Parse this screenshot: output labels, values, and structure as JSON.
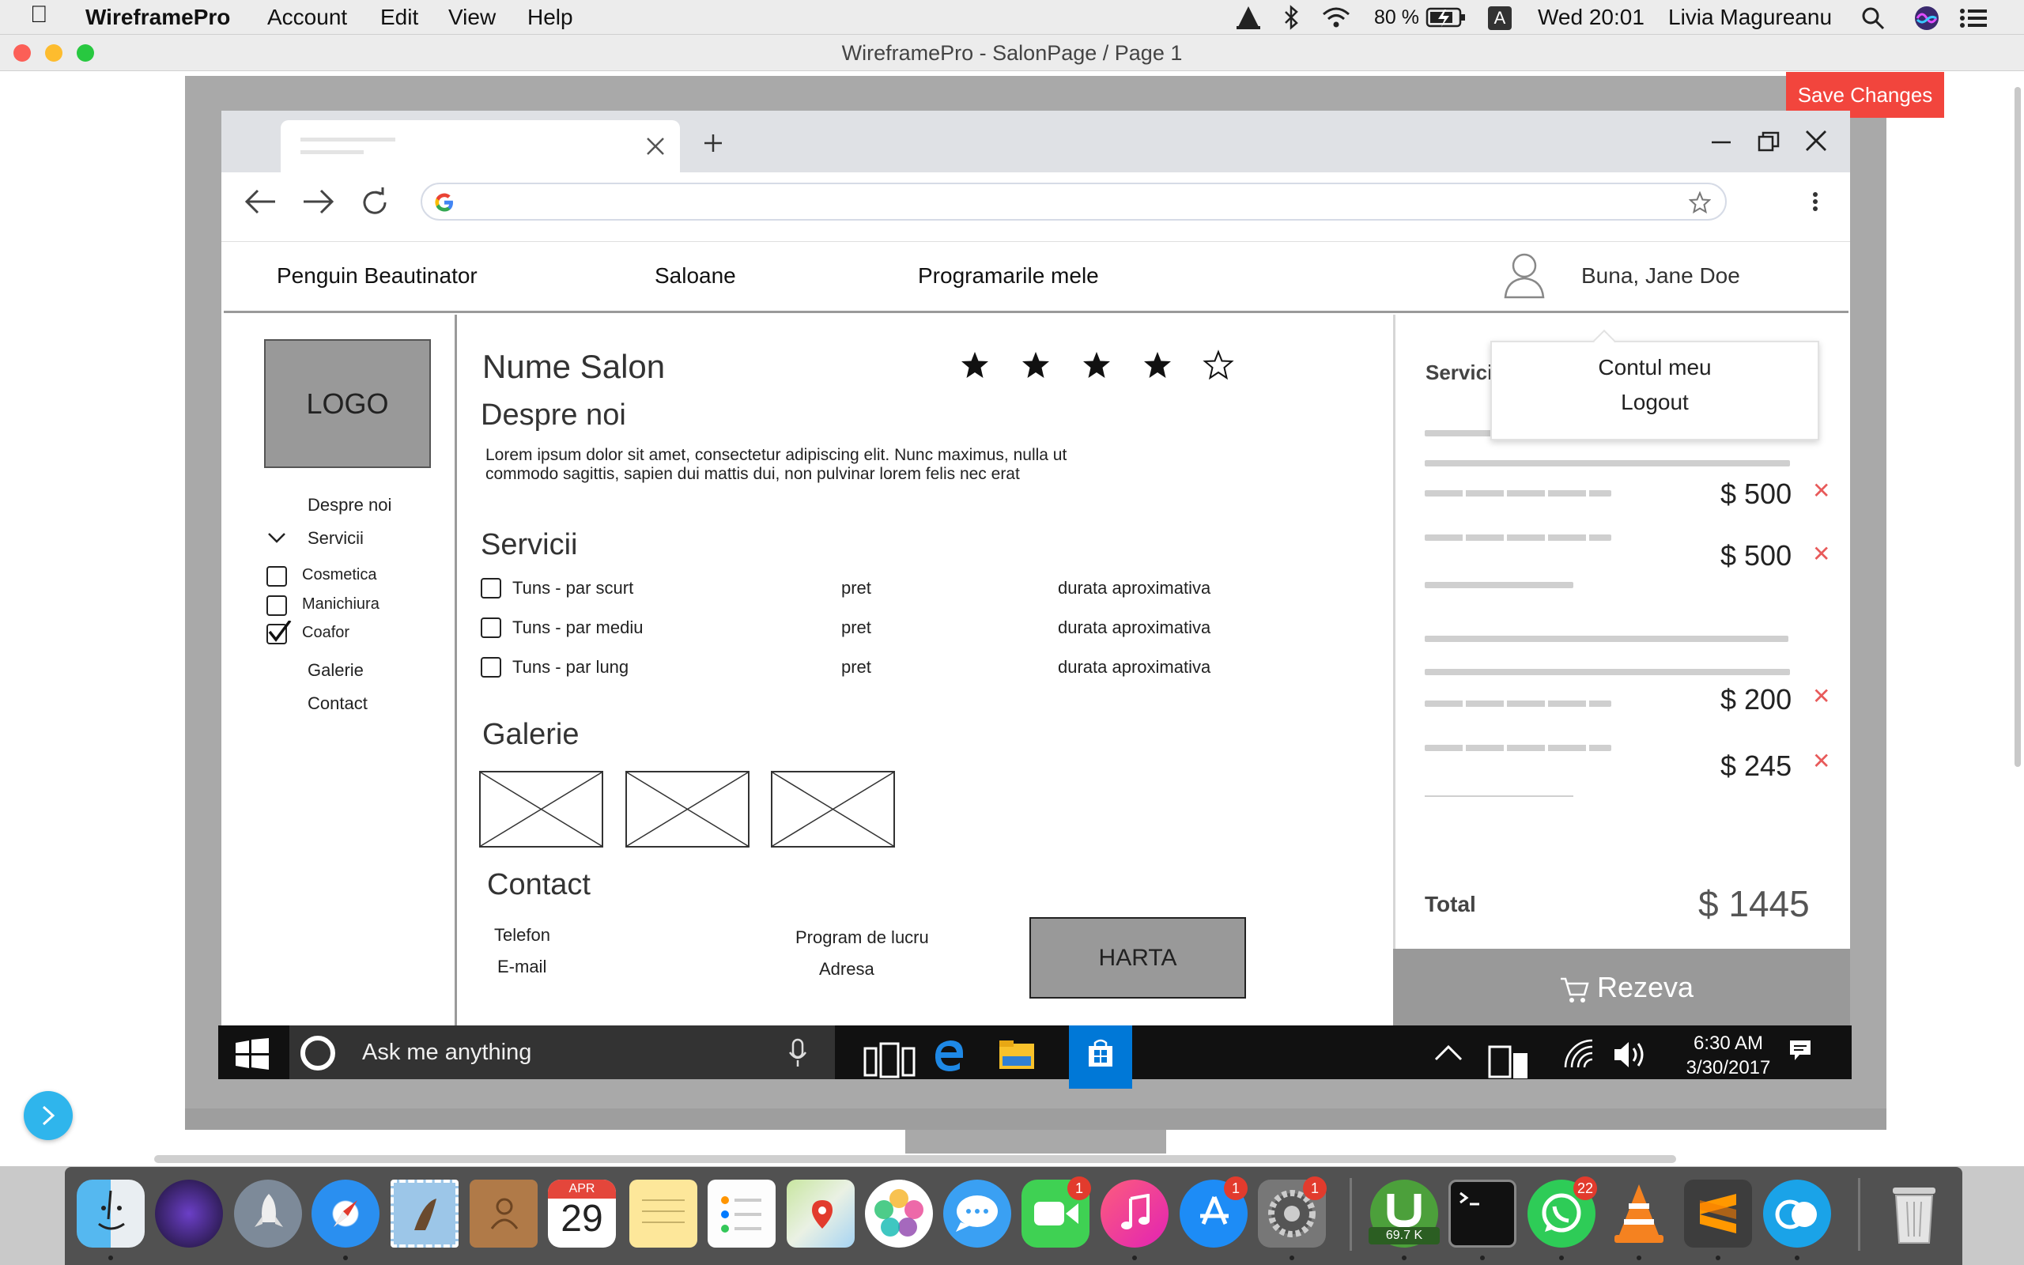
{
  "menubar": {
    "app_name": "WireframePro",
    "menus": [
      "Account",
      "Edit",
      "View",
      "Help"
    ],
    "battery": "80 %",
    "input_source": "A",
    "datetime": "Wed 20:01",
    "user": "Livia Magureanu"
  },
  "window": {
    "title": "WireframePro - SalonPage / Page 1"
  },
  "toolbar": {
    "save_label": "Save Changes"
  },
  "site": {
    "nav": {
      "brand": "Penguin Beautinator",
      "saloane": "Saloane",
      "programari": "Programarile mele",
      "greeting": "Buna, Jane Doe"
    },
    "user_menu": {
      "account": "Contul meu",
      "logout": "Logout"
    },
    "sidebar": {
      "logo": "LOGO",
      "about": "Despre noi",
      "services": "Servicii",
      "filters": [
        {
          "label": "Cosmetica",
          "checked": false
        },
        {
          "label": "Manichiura",
          "checked": false
        },
        {
          "label": "Coafor",
          "checked": true
        }
      ],
      "gallery": "Galerie",
      "contact": "Contact"
    },
    "salon": {
      "name": "Nume Salon",
      "rating": 4,
      "rating_max": 5,
      "about_title": "Despre noi",
      "about_text_1": "Lorem ipsum dolor sit amet, consectetur adipiscing elit. Nunc maximus, nulla ut",
      "about_text_2": "commodo sagittis, sapien dui mattis dui, non pulvinar lorem felis nec erat",
      "services_title": "Servicii",
      "services": [
        {
          "name": "Tuns - par scurt",
          "price": "pret",
          "duration": "durata aproximativa"
        },
        {
          "name": "Tuns - par mediu",
          "price": "pret",
          "duration": "durata aproximativa"
        },
        {
          "name": "Tuns - par lung",
          "price": "pret",
          "duration": "durata aproximativa"
        }
      ],
      "gallery_title": "Galerie",
      "contact_title": "Contact",
      "phone": "Telefon",
      "email": "E-mail",
      "schedule": "Program de lucru",
      "address": "Adresa",
      "map": "HARTA"
    },
    "cart": {
      "title": "Servici",
      "items": [
        "$ 500",
        "$ 500",
        "$ 200",
        "$ 245"
      ],
      "total_label": "Total",
      "total_value": "$ 1445",
      "book_label": "Rezeva"
    }
  },
  "taskbar": {
    "search_placeholder": "Ask me anything",
    "time": "6:30 AM",
    "date": "3/30/2017"
  },
  "dock": {
    "calendar_month": "APR",
    "calendar_day": "29",
    "facetime_badge": "1",
    "appstore_badge": "1",
    "prefs_badge": "1",
    "whatsapp_badge": "22",
    "utorrent_speed": "69.7 K"
  },
  "colors": {
    "save_button": "#f2453d",
    "placeholder_gray": "#999999",
    "accent_blue": "#0078d7",
    "remove_red": "#e85a5a"
  }
}
